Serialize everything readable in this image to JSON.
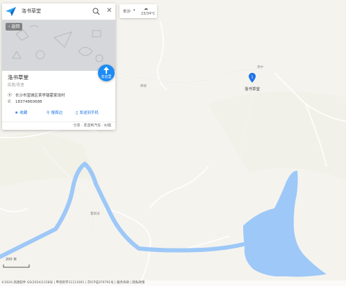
{
  "search": {
    "query": "洛书草堂"
  },
  "poi": {
    "back_label": "返回",
    "go_label": "去这里",
    "name": "洛书草堂",
    "type": "民居/农舍",
    "address": "长沙市望城区茶亭镇霍家垅村",
    "phone": "18374860688",
    "actions": [
      {
        "label": "收藏",
        "icon": "star-icon"
      },
      {
        "label": "搜周边",
        "icon": "nearby-icon"
      },
      {
        "label": "发送到手机",
        "icon": "phone-icon"
      }
    ],
    "footer": "分享 · 发送到汽车 · 纠错"
  },
  "city": {
    "name": "长沙",
    "weather": "cloudy",
    "temp": "23/34°C"
  },
  "map": {
    "labels": [
      "樟坡",
      "茶中",
      "霍家垅"
    ],
    "marker_label": "洛书草堂",
    "marker_number": "1",
    "scale": "200 米",
    "copyright": "©2024 高德软件 GS(2024)1158号 | 甲测资字11111001 | 京ICP证070791号 | 服务条款 | 隐私政策"
  },
  "colors": {
    "land": "#f5f3ee",
    "water": "#9dc8f8",
    "road": "#ffffff",
    "accent": "#1c8bf5"
  }
}
